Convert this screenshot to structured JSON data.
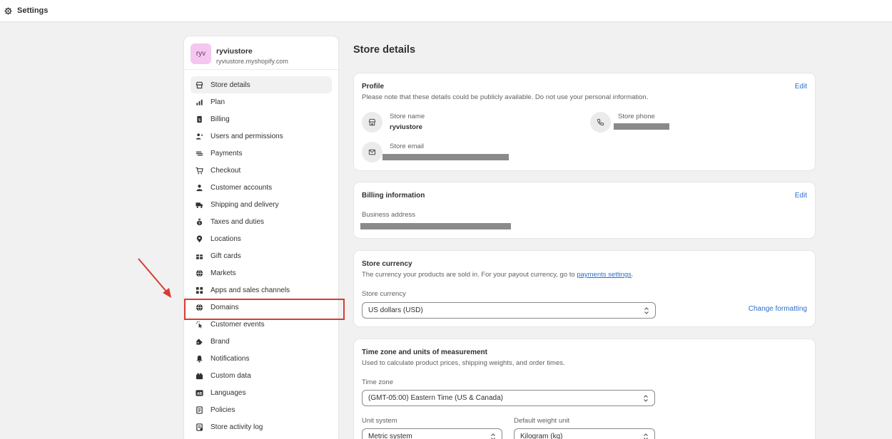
{
  "topbar": {
    "title": "Settings"
  },
  "store": {
    "avatar": "ryv",
    "name": "ryviustore",
    "domain": "ryviustore.myshopify.com"
  },
  "nav": [
    {
      "label": "Store details",
      "icon": "store-icon"
    },
    {
      "label": "Plan",
      "icon": "plan-icon"
    },
    {
      "label": "Billing",
      "icon": "billing-icon"
    },
    {
      "label": "Users and permissions",
      "icon": "users-icon"
    },
    {
      "label": "Payments",
      "icon": "payments-icon"
    },
    {
      "label": "Checkout",
      "icon": "cart-icon"
    },
    {
      "label": "Customer accounts",
      "icon": "person-icon"
    },
    {
      "label": "Shipping and delivery",
      "icon": "truck-icon"
    },
    {
      "label": "Taxes and duties",
      "icon": "tax-icon"
    },
    {
      "label": "Locations",
      "icon": "location-icon"
    },
    {
      "label": "Gift cards",
      "icon": "gift-icon"
    },
    {
      "label": "Markets",
      "icon": "globe-icon"
    },
    {
      "label": "Apps and sales channels",
      "icon": "apps-icon"
    },
    {
      "label": "Domains",
      "icon": "globe-icon"
    },
    {
      "label": "Customer events",
      "icon": "cursor-icon"
    },
    {
      "label": "Brand",
      "icon": "brand-icon"
    },
    {
      "label": "Notifications",
      "icon": "bell-icon"
    },
    {
      "label": "Custom data",
      "icon": "data-icon"
    },
    {
      "label": "Languages",
      "icon": "language-icon"
    },
    {
      "label": "Policies",
      "icon": "policy-icon"
    },
    {
      "label": "Store activity log",
      "icon": "activity-icon"
    }
  ],
  "main": {
    "title": "Store details",
    "profile": {
      "title": "Profile",
      "subtitle": "Please note that these details could be publicly available. Do not use your personal information.",
      "edit": "Edit",
      "store_name_label": "Store name",
      "store_name_value": "ryviustore",
      "store_phone_label": "Store phone",
      "store_email_label": "Store email"
    },
    "billing": {
      "title": "Billing information",
      "edit": "Edit",
      "address_label": "Business address"
    },
    "currency": {
      "title": "Store currency",
      "subtitle_pre": "The currency your products are sold in. For your payout currency, go to ",
      "subtitle_link": "payments settings",
      "subtitle_post": ".",
      "field_label": "Store currency",
      "value": "US dollars (USD)",
      "change_formatting": "Change formatting"
    },
    "timezone": {
      "title": "Time zone and units of measurement",
      "subtitle": "Used to calculate product prices, shipping weights, and order times.",
      "tz_label": "Time zone",
      "tz_value": "(GMT-05:00) Eastern Time (US & Canada)",
      "unit_label": "Unit system",
      "unit_value": "Metric system",
      "weight_label": "Default weight unit",
      "weight_value": "Kilogram (kg)"
    }
  },
  "colors": {
    "accent": "#2c6ecb",
    "highlight": "#d93b35",
    "avatar": "#f5c6f0"
  }
}
